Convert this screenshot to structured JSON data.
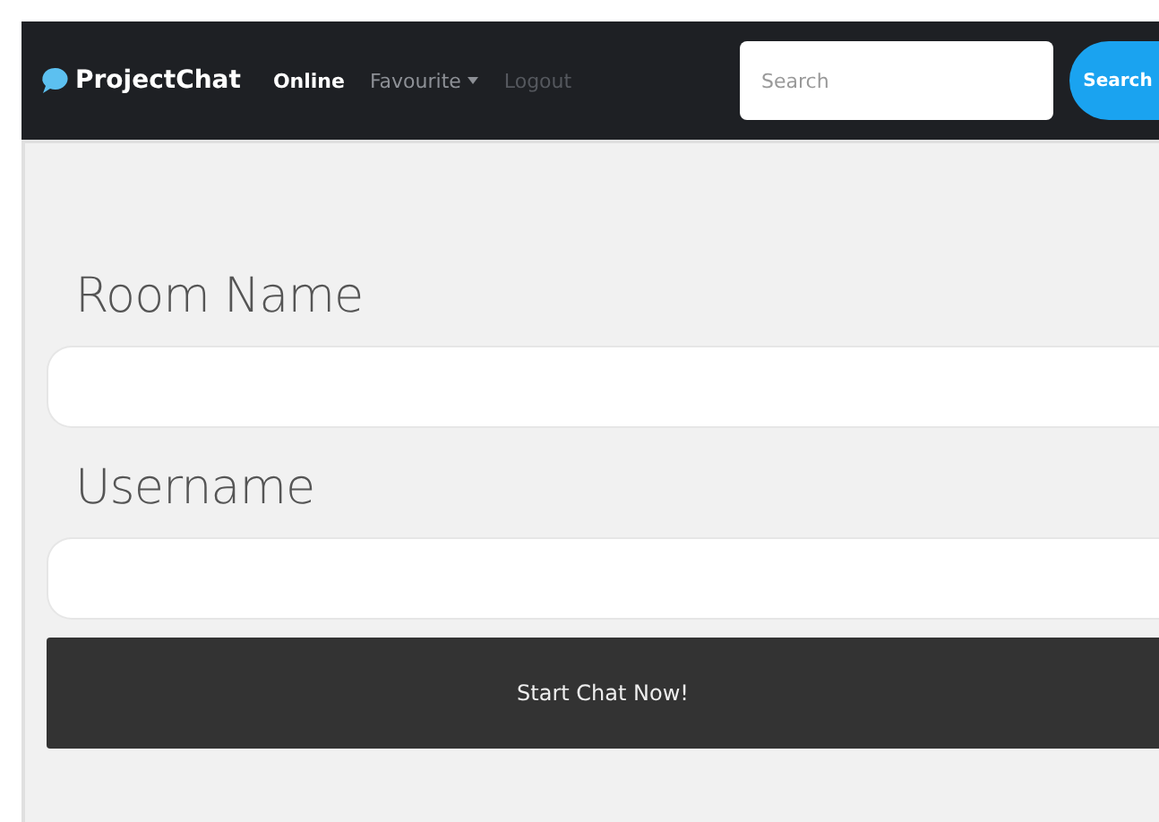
{
  "navbar": {
    "brand": "ProjectChat",
    "items": [
      {
        "label": "Online",
        "selected": true,
        "disabled": false,
        "dropdown": false
      },
      {
        "label": "Favourite",
        "selected": false,
        "disabled": false,
        "dropdown": true
      },
      {
        "label": "Logout",
        "selected": false,
        "disabled": true,
        "dropdown": false
      }
    ],
    "search": {
      "placeholder": "Search",
      "button": "Search"
    }
  },
  "form": {
    "fields": [
      {
        "label": "Room Name"
      },
      {
        "label": "Username"
      }
    ],
    "submit": "Start Chat Now!"
  }
}
